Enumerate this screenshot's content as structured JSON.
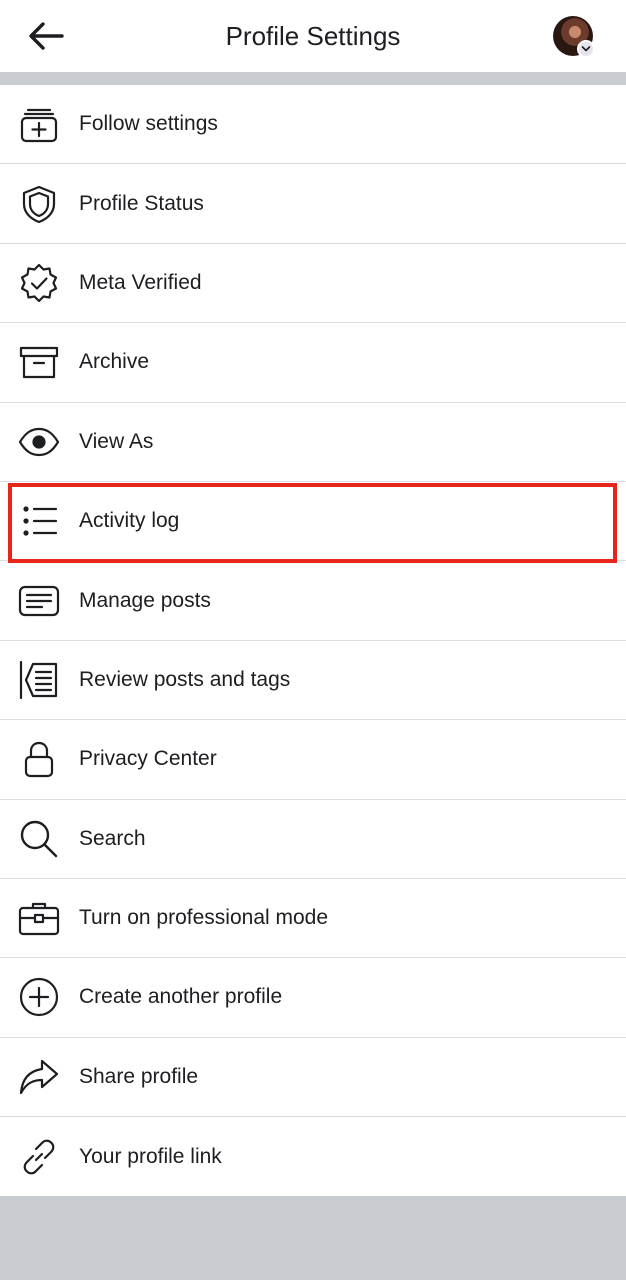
{
  "header": {
    "title": "Profile Settings",
    "back_icon": "arrow-left-icon",
    "avatar_badge_icon": "chevron-down-icon"
  },
  "menu": {
    "items": [
      {
        "label": "Follow settings",
        "icon": "follow-settings-icon"
      },
      {
        "label": "Profile Status",
        "icon": "shield-icon"
      },
      {
        "label": "Meta Verified",
        "icon": "verified-badge-icon"
      },
      {
        "label": "Archive",
        "icon": "archive-box-icon"
      },
      {
        "label": "View As",
        "icon": "eye-icon"
      },
      {
        "label": "Activity log",
        "icon": "list-icon"
      },
      {
        "label": "Manage posts",
        "icon": "posts-icon"
      },
      {
        "label": "Review posts and tags",
        "icon": "review-tags-icon"
      },
      {
        "label": "Privacy Center",
        "icon": "lock-icon"
      },
      {
        "label": "Search",
        "icon": "search-icon"
      },
      {
        "label": "Turn on professional mode",
        "icon": "briefcase-icon"
      },
      {
        "label": "Create another profile",
        "icon": "plus-circle-icon"
      },
      {
        "label": "Share profile",
        "icon": "share-arrow-icon"
      },
      {
        "label": "Your profile link",
        "icon": "link-icon"
      }
    ]
  },
  "highlight": {
    "target": "Activity log",
    "color": "#e8251b"
  },
  "colors": {
    "background_band": "#c9ccd1",
    "text": "#1c1e21",
    "divider": "#dadde1"
  }
}
